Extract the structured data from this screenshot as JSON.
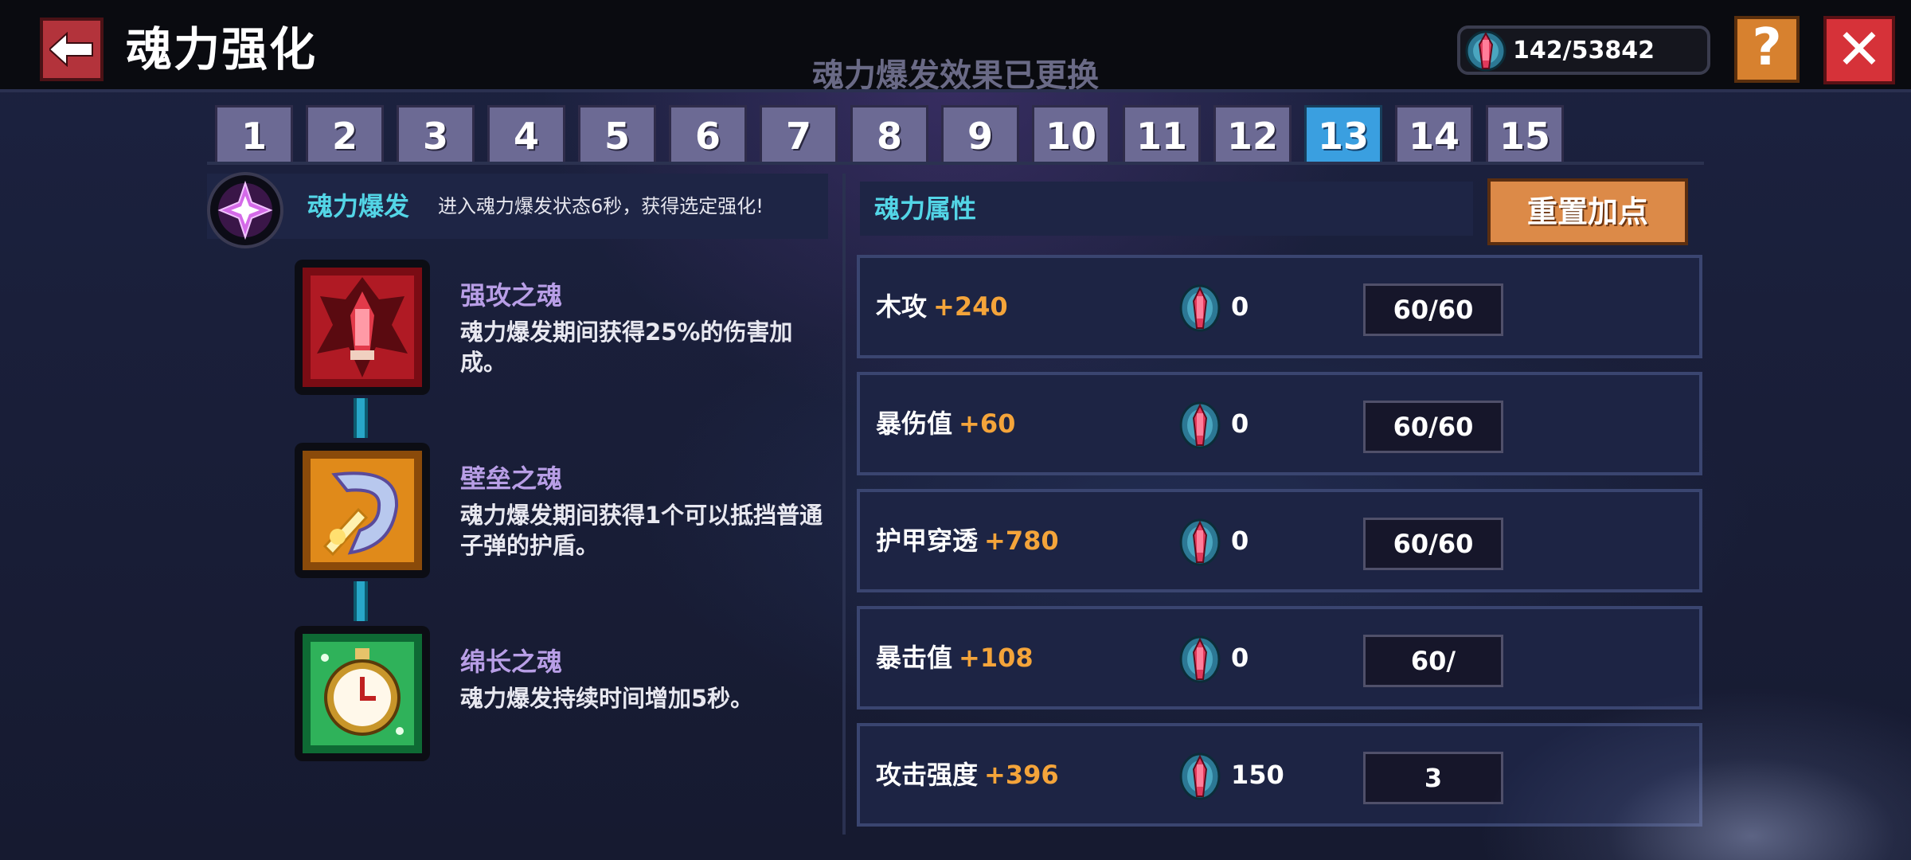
{
  "header": {
    "title": "魂力强化",
    "toast": "魂力爆发效果已更换",
    "currency": "142/53842",
    "help_label": "?",
    "close_label": "✕"
  },
  "tabs": [
    "1",
    "2",
    "3",
    "4",
    "5",
    "6",
    "7",
    "8",
    "9",
    "10",
    "11",
    "12",
    "13",
    "14",
    "15"
  ],
  "active_tab": "13",
  "burst": {
    "title": "魂力爆发",
    "description": "进入魂力爆发状态6秒，获得选定强化!"
  },
  "souls": [
    {
      "name": "强攻之魂",
      "description": "魂力爆发期间获得25%的伤害加成。",
      "icon": "attack-soul-icon"
    },
    {
      "name": "壁垒之魂",
      "description": "魂力爆发期间获得1个可以抵挡普通子弹的护盾。",
      "icon": "shield-soul-icon"
    },
    {
      "name": "绵长之魂",
      "description": "魂力爆发持续时间增加5秒。",
      "icon": "stopwatch-soul-icon"
    }
  ],
  "attributes": {
    "title": "魂力属性",
    "reset_label": "重置加点",
    "rows": [
      {
        "name": "木攻",
        "bonus": "+240",
        "cost": "0",
        "level": "60/60"
      },
      {
        "name": "暴伤值",
        "bonus": "+60",
        "cost": "0",
        "level": "60/60"
      },
      {
        "name": "护甲穿透",
        "bonus": "+780",
        "cost": "0",
        "level": "60/60"
      },
      {
        "name": "暴击值",
        "bonus": "+108",
        "cost": "0",
        "level": "60/"
      },
      {
        "name": "攻击强度",
        "bonus": "+396",
        "cost": "150",
        "level": "3"
      }
    ]
  },
  "colors": {
    "accent_cyan": "#53d5e6",
    "bonus_orange": "#f4a43a",
    "active_tab": "#3a9fe0",
    "reset_button": "#dc8a48"
  }
}
